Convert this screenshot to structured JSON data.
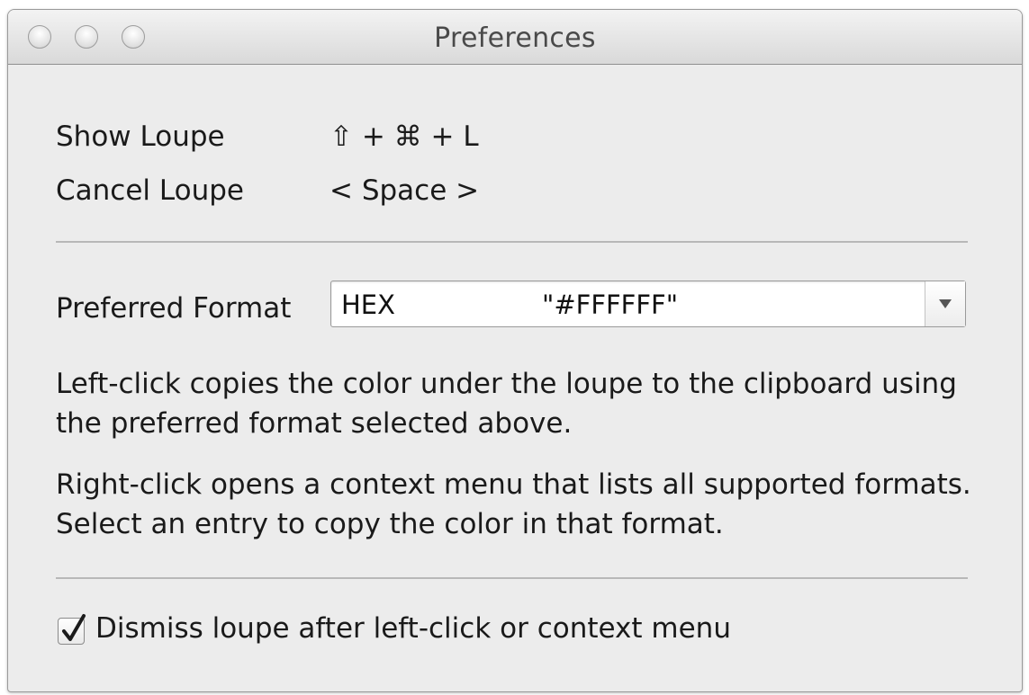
{
  "window": {
    "title": "Preferences"
  },
  "shortcuts": [
    {
      "label": "Show Loupe",
      "value": "⇧ + ⌘ + L"
    },
    {
      "label": "Cancel Loupe",
      "value": "< Space >"
    }
  ],
  "format": {
    "label": "Preferred Format",
    "selected_name": "HEX",
    "selected_example": "\"#FFFFFF\""
  },
  "help": {
    "left_click": "Left-click copies the color under the loupe to the clipboard using the preferred format selected above.",
    "right_click": "Right-click opens a context menu that lists all supported formats. Select an entry to copy the color in that format."
  },
  "dismiss": {
    "label": "Dismiss loupe after left-click or context menu",
    "checked": true
  },
  "icons": {
    "close": "close-icon",
    "minimize": "minimize-icon",
    "maximize": "zoom-icon",
    "dropdown": "chevron-down-icon",
    "check": "checkmark-icon"
  }
}
